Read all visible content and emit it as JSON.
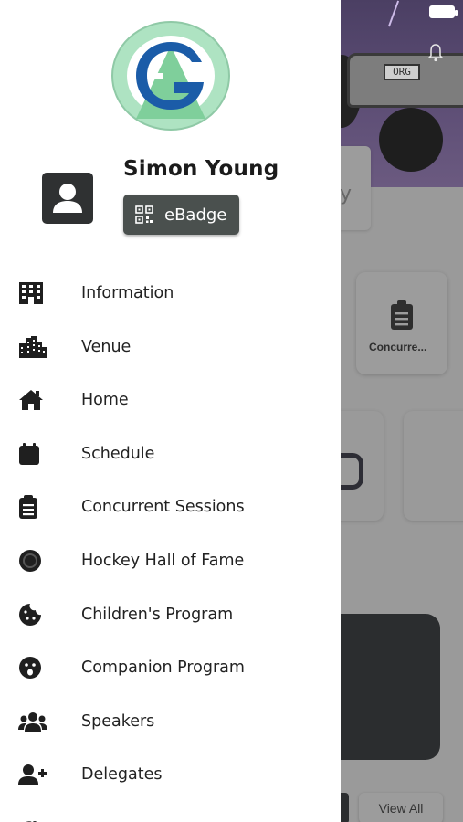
{
  "background": {
    "plate_text": "ORG",
    "card_text": "y",
    "tile_label": "Concurre...",
    "view_all_label": "View All"
  },
  "drawer": {
    "user_name": "Simon Young",
    "ebadge_label": "eBadge",
    "menu": [
      {
        "label": "Information",
        "icon": "building-icon"
      },
      {
        "label": "Venue",
        "icon": "city-icon"
      },
      {
        "label": "Home",
        "icon": "home-icon"
      },
      {
        "label": "Schedule",
        "icon": "calendar-icon"
      },
      {
        "label": "Concurrent Sessions",
        "icon": "clipboard-icon"
      },
      {
        "label": "Hockey Hall of Fame",
        "icon": "hockey-puck-icon"
      },
      {
        "label": "Children's Program",
        "icon": "cookie-icon"
      },
      {
        "label": "Companion Program",
        "icon": "face-icon"
      },
      {
        "label": "Speakers",
        "icon": "users-icon"
      },
      {
        "label": "Delegates",
        "icon": "user-plus-icon"
      }
    ]
  },
  "colors": {
    "drawer_bg": "#ffffff",
    "ebadge_bg": "#4a504e",
    "icon_color": "#1f1f1f",
    "logo_green": "#8fd3a8",
    "logo_blue": "#1b5ca8"
  }
}
